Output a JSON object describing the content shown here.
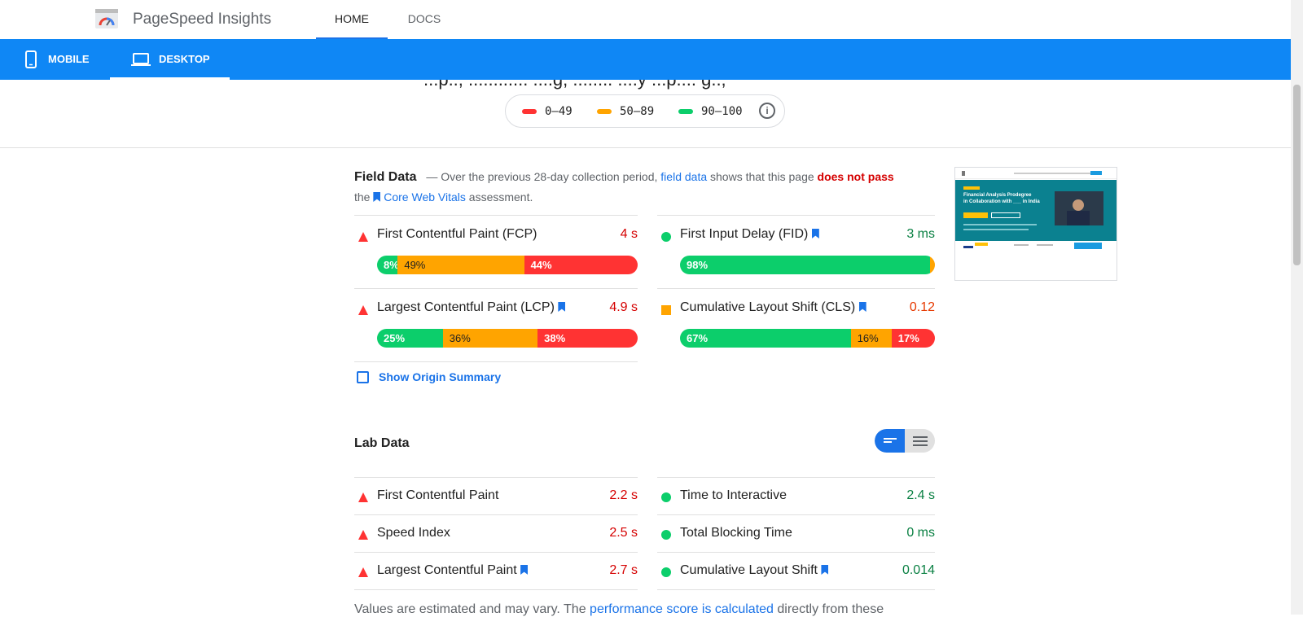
{
  "header": {
    "app_title": "PageSpeed Insights",
    "nav_tabs": [
      {
        "label": "HOME",
        "active": true
      },
      {
        "label": "DOCS",
        "active": false
      }
    ],
    "device_tabs": [
      {
        "label": "MOBILE",
        "icon": "phone-icon",
        "active": false
      },
      {
        "label": "DESKTOP",
        "icon": "laptop-icon",
        "active": true
      }
    ],
    "accent_color": "#0f87f5"
  },
  "cut_off_text": "...p.., ............ ....g, ........ ....y ...p.... g..,",
  "legend": {
    "ranges": [
      {
        "label": "0–49",
        "color": "#ff3333"
      },
      {
        "label": "50–89",
        "color": "#ffa400"
      },
      {
        "label": "90–100",
        "color": "#0cce6b"
      }
    ],
    "info_icon": "info-icon"
  },
  "field_data": {
    "title": "Field Data",
    "desc_prefix": "— Over the previous 28-day collection period,",
    "desc_link": "field data",
    "desc_mid": "shows that this page",
    "desc_fail": "does not pass",
    "desc_the": "the",
    "desc_cwv": "Core Web Vitals",
    "desc_suffix": "assessment.",
    "metrics": [
      {
        "name": "First Contentful Paint (FCP)",
        "value": "4 s",
        "status": "fail",
        "bookmark": false,
        "dist": [
          "8%",
          "49%",
          "44%"
        ]
      },
      {
        "name": "First Input Delay (FID)",
        "value": "3 ms",
        "status": "pass",
        "bookmark": true,
        "dist": [
          "98%",
          "1%",
          "1%"
        ]
      },
      {
        "name": "Largest Contentful Paint (LCP)",
        "value": "4.9 s",
        "status": "fail",
        "bookmark": true,
        "dist": [
          "25%",
          "36%",
          "38%"
        ]
      },
      {
        "name": "Cumulative Layout Shift (CLS)",
        "value": "0.12",
        "status": "average",
        "bookmark": true,
        "dist": [
          "67%",
          "16%",
          "17%"
        ]
      }
    ],
    "dist_values": [
      [
        8,
        49,
        44
      ],
      [
        98,
        1,
        1
      ],
      [
        25,
        36,
        38
      ],
      [
        67,
        16,
        17
      ]
    ],
    "show_origin_label": "Show Origin Summary"
  },
  "lab_data": {
    "title": "Lab Data",
    "metrics": [
      {
        "name": "First Contentful Paint",
        "value": "2.2 s",
        "status": "fail"
      },
      {
        "name": "Time to Interactive",
        "value": "2.4 s",
        "status": "pass"
      },
      {
        "name": "Speed Index",
        "value": "2.5 s",
        "status": "fail"
      },
      {
        "name": "Total Blocking Time",
        "value": "0 ms",
        "status": "pass"
      },
      {
        "name": "Largest Contentful Paint",
        "value": "2.7 s",
        "status": "fail"
      },
      {
        "name": "Cumulative Layout Shift",
        "value": "0.014",
        "status": "pass"
      }
    ],
    "toggle_icons": [
      "bar-view-icon",
      "list-view-icon"
    ]
  },
  "screenshot_thumb": {
    "headline_1": "Financial Analysis Prodegree",
    "headline_2": "in Collaboration with ___ in India"
  },
  "footnote": {
    "prefix": "Values are estimated and may vary. The",
    "link": "performance score is calculated",
    "suffix": "directly from these"
  }
}
